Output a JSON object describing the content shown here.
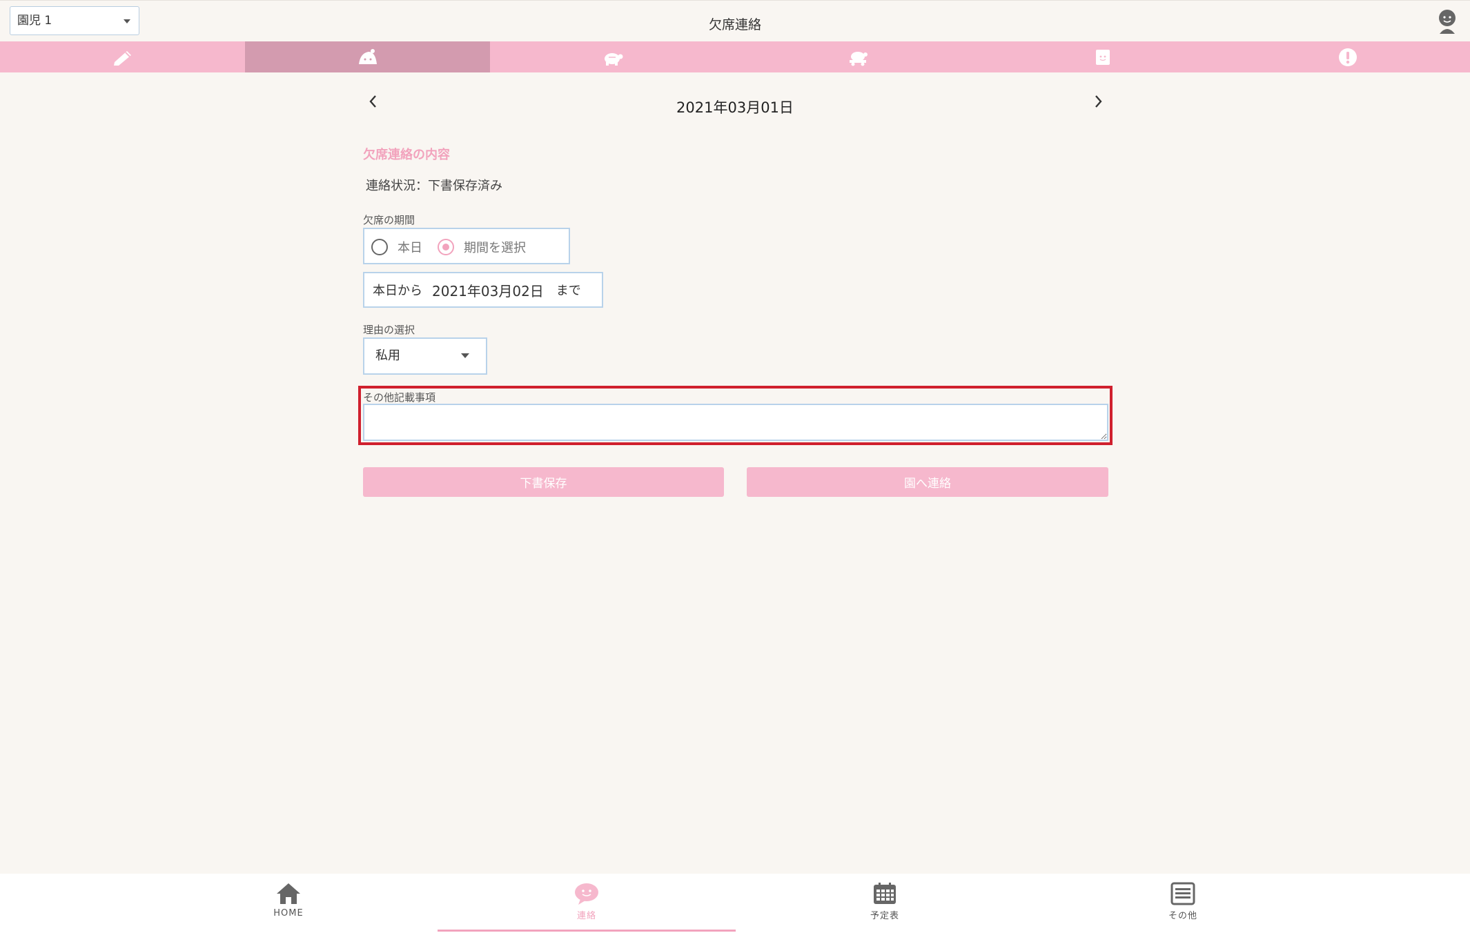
{
  "header": {
    "child_select_value": "園児 1",
    "title": "欠席連絡",
    "avatar_icon": "user-avatar-icon"
  },
  "tabs": [
    {
      "icon": "pencil-icon",
      "active": false
    },
    {
      "icon": "sick-child-icon",
      "active": true
    },
    {
      "icon": "turtle-icon",
      "active": false
    },
    {
      "icon": "turtle-cart-icon",
      "active": false
    },
    {
      "icon": "note-icon",
      "active": false
    },
    {
      "icon": "alert-icon",
      "active": false
    }
  ],
  "date_nav": {
    "date": "2021年03月01日"
  },
  "form": {
    "section_title": "欠席連絡の内容",
    "status_text": "連絡状況：下書保存済み",
    "period_label": "欠席の期間",
    "radio_today": "本日",
    "radio_period": "期間を選択",
    "selected_radio": "期間を選択",
    "period_from": "本日から",
    "period_end_date": "2021年03月02日",
    "period_to": "まで",
    "reason_label": "理由の選択",
    "reason_value": "私用",
    "notes_label": "その他記載事項",
    "notes_value": "",
    "draft_button": "下書保存",
    "send_button": "園へ連絡"
  },
  "colors": {
    "accent_pink": "#f6b8cd",
    "active_tab": "#d39baf",
    "highlight_red": "#d0202e",
    "background": "#f9f6f2"
  },
  "bottom_nav": [
    {
      "label": "HOME",
      "icon": "home-icon",
      "active": false
    },
    {
      "label": "連絡",
      "icon": "chat-icon",
      "active": true
    },
    {
      "label": "予定表",
      "icon": "calendar-icon",
      "active": false
    },
    {
      "label": "その他",
      "icon": "menu-icon",
      "active": false
    }
  ]
}
